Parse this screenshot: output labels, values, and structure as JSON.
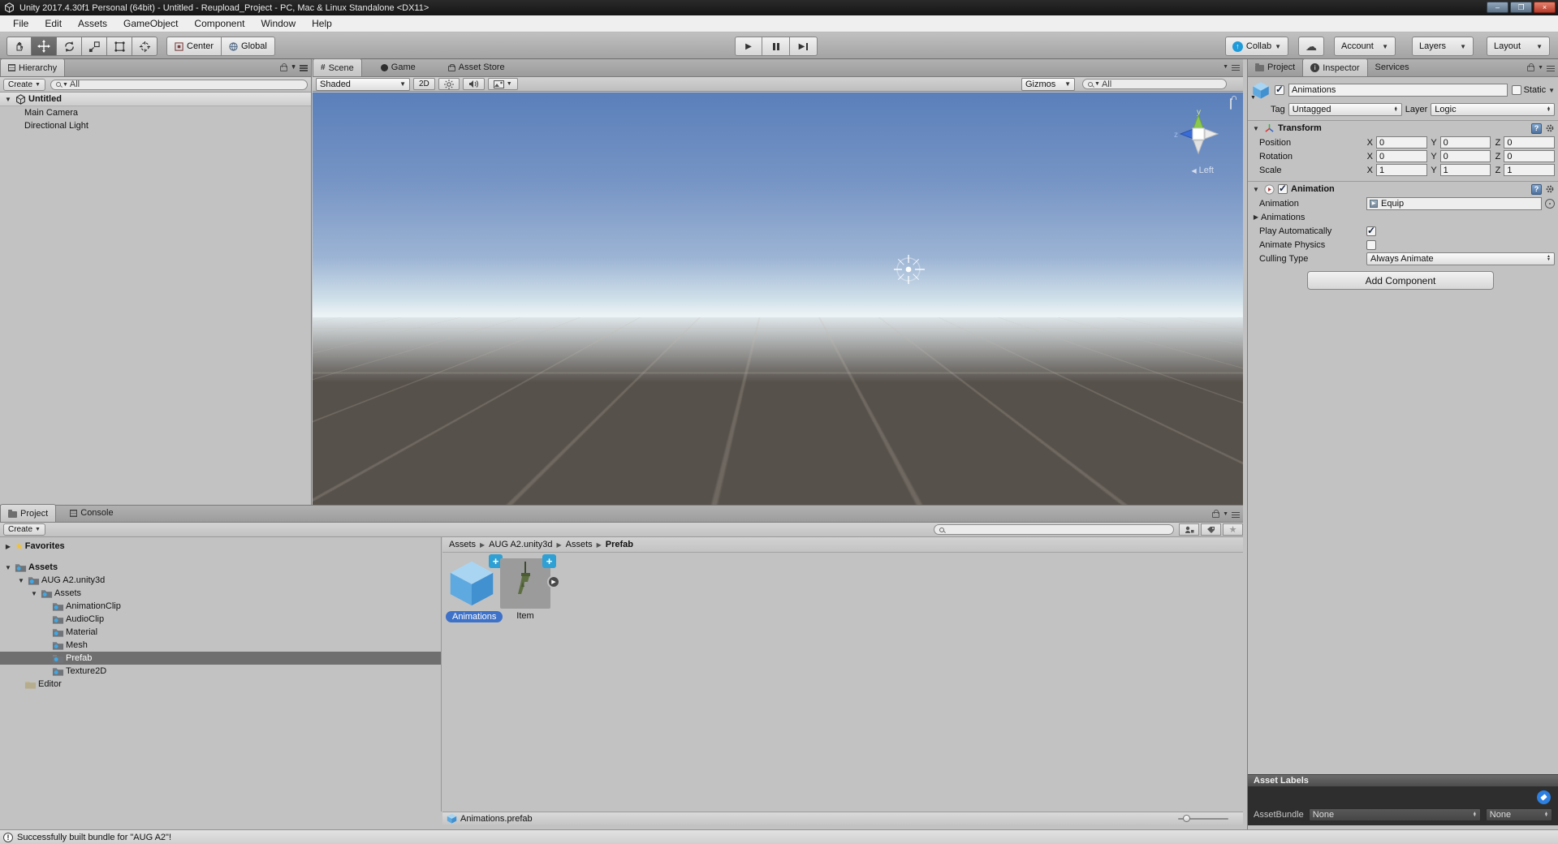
{
  "window": {
    "title": "Unity 2017.4.30f1 Personal (64bit) - Untitled - Reupload_Project - PC, Mac & Linux Standalone <DX11>"
  },
  "menu": {
    "items": [
      "File",
      "Edit",
      "Assets",
      "GameObject",
      "Component",
      "Window",
      "Help"
    ]
  },
  "toolbar": {
    "center": "Center",
    "global": "Global",
    "collab": "Collab",
    "account": "Account",
    "layers": "Layers",
    "layout": "Layout"
  },
  "hierarchy": {
    "tab": "Hierarchy",
    "create": "Create",
    "search_value": "All",
    "scene_name": "Untitled",
    "items": [
      {
        "label": "Main Camera"
      },
      {
        "label": "Directional Light"
      }
    ]
  },
  "scene": {
    "tabs": [
      {
        "label": "Scene"
      },
      {
        "label": "Game"
      },
      {
        "label": "Asset Store"
      }
    ],
    "shading_mode": "Shaded",
    "mode_2d": "2D",
    "gizmos": "Gizmos",
    "search_value": "All",
    "axis_y": "y",
    "axis_z": "z",
    "view_label": "Left"
  },
  "inspector": {
    "tabs": [
      {
        "label": "Project"
      },
      {
        "label": "Inspector"
      },
      {
        "label": "Services"
      }
    ],
    "object_name": "Animations",
    "enabled": true,
    "static_label": "Static",
    "static_checked": false,
    "tag_label": "Tag",
    "tag_value": "Untagged",
    "layer_label": "Layer",
    "layer_value": "Logic",
    "transform": {
      "title": "Transform",
      "x": "X",
      "y": "Y",
      "z": "Z",
      "rows": [
        {
          "label": "Position",
          "x": "0",
          "y": "0",
          "z": "0"
        },
        {
          "label": "Rotation",
          "x": "0",
          "y": "0",
          "z": "0"
        },
        {
          "label": "Scale",
          "x": "1",
          "y": "1",
          "z": "1"
        }
      ]
    },
    "animation": {
      "title": "Animation",
      "enabled": true,
      "clip_label": "Animation",
      "clip_value": "Equip",
      "list_label": "Animations",
      "play_label": "Play Automatically",
      "play_checked": true,
      "physics_label": "Animate Physics",
      "physics_checked": false,
      "culling_label": "Culling Type",
      "culling_value": "Always Animate"
    },
    "add_component": "Add Component",
    "asset_labels": {
      "title": "Asset Labels",
      "bundle_label": "AssetBundle",
      "bundle_value": "None",
      "variant_value": "None"
    }
  },
  "project": {
    "tabs": [
      {
        "label": "Project"
      },
      {
        "label": "Console"
      }
    ],
    "create": "Create",
    "favorites": "Favorites",
    "tree": [
      {
        "label": "Assets"
      },
      {
        "label": "AUG A2.unity3d"
      },
      {
        "label": "Assets"
      },
      {
        "label": "AnimationClip"
      },
      {
        "label": "AudioClip"
      },
      {
        "label": "Material"
      },
      {
        "label": "Mesh"
      },
      {
        "label": "Prefab"
      },
      {
        "label": "Texture2D"
      },
      {
        "label": "Editor"
      }
    ],
    "breadcrumb": [
      {
        "label": "Assets"
      },
      {
        "label": "AUG A2.unity3d"
      },
      {
        "label": "Assets"
      },
      {
        "label": "Prefab"
      }
    ],
    "assets": [
      {
        "label": "Animations"
      },
      {
        "label": "Item"
      }
    ],
    "selected_file": "Animations.prefab"
  },
  "status": {
    "message": "Successfully built bundle for \"AUG A2\"!"
  },
  "colors": {
    "selection_pill": "#3e71c8",
    "add_badge_blue": "#2fa0d4",
    "asset_label_tag_blue": "#2d7fe0",
    "collab_blue": "#1f9bd9",
    "sky_top": "#5a7fba",
    "ground": "#57514b"
  }
}
